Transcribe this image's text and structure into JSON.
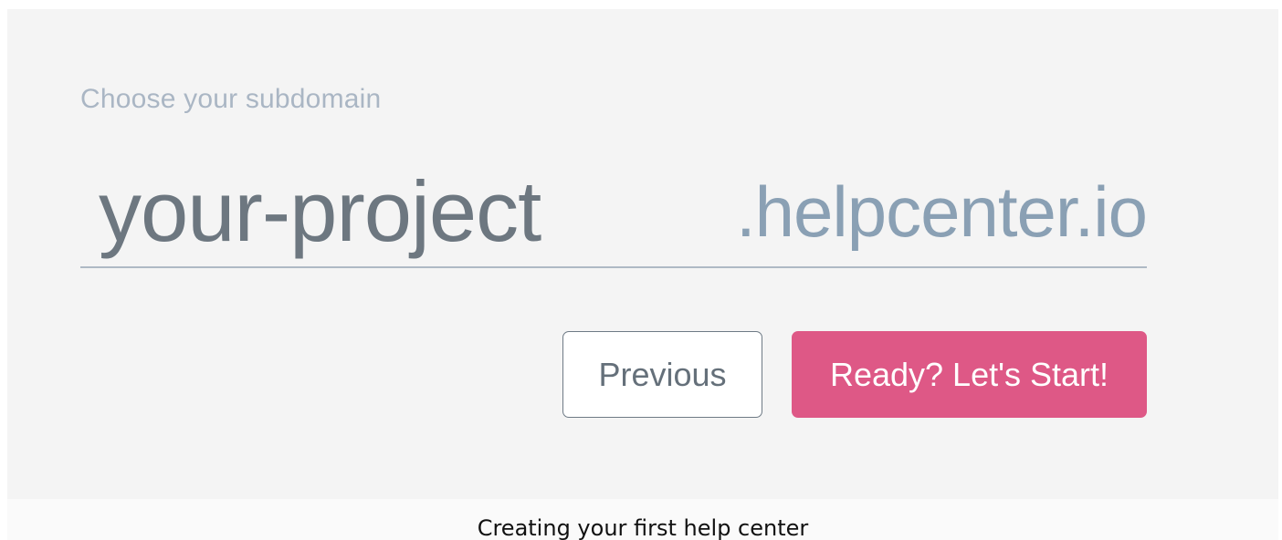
{
  "form": {
    "label": "Choose your subdomain",
    "subdomain_value": "your-project",
    "domain_suffix": ".helpcenter.io"
  },
  "buttons": {
    "previous_label": "Previous",
    "start_label": "Ready? Let's Start!"
  },
  "caption": "Creating your first help center",
  "colors": {
    "accent": "#de5886",
    "card_background": "#f4f4f4",
    "label": "#aab6c4",
    "suffix": "#8aa0b4",
    "input_text": "#6d7780"
  }
}
